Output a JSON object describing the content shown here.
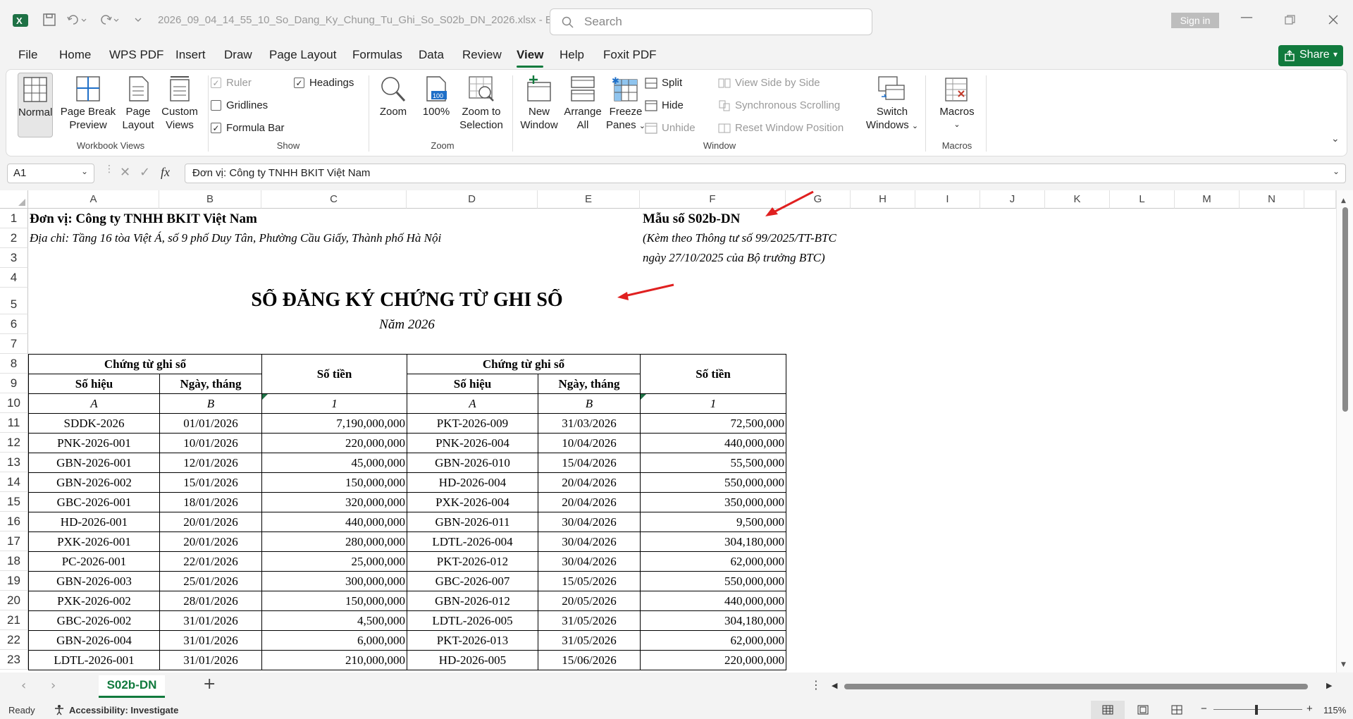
{
  "window": {
    "filename": "2026_09_04_14_55_10_So_Dang_Ky_Chung_Tu_Ghi_So_S02b_DN_2026.xlsx  -  E...",
    "search_placeholder": "Search",
    "signin": "Sign in"
  },
  "menu": [
    "File",
    "Home",
    "WPS PDF",
    "Insert",
    "Draw",
    "Page Layout",
    "Formulas",
    "Data",
    "Review",
    "View",
    "Help",
    "Foxit PDF"
  ],
  "active_menu": "View",
  "share_label": "Share",
  "ribbon": {
    "workbook_views": {
      "label": "Workbook Views",
      "normal": "Normal",
      "page_break": [
        "Page Break",
        "Preview"
      ],
      "page_layout": [
        "Page",
        "Layout"
      ],
      "custom": [
        "Custom",
        "Views"
      ]
    },
    "show": {
      "label": "Show",
      "ruler": "Ruler",
      "gridlines": "Gridlines",
      "formula_bar": "Formula Bar",
      "headings": "Headings"
    },
    "zoom": {
      "label": "Zoom",
      "zoom": "Zoom",
      "hundred": "100%",
      "selection": [
        "Zoom to",
        "Selection"
      ]
    },
    "window": {
      "label": "Window",
      "new_window": [
        "New",
        "Window"
      ],
      "arrange": [
        "Arrange",
        "All"
      ],
      "freeze": [
        "Freeze",
        "Panes"
      ],
      "split": "Split",
      "hide": "Hide",
      "unhide": "Unhide",
      "side_by_side": "View Side by Side",
      "sync": "Synchronous Scrolling",
      "reset": "Reset Window Position",
      "switch": [
        "Switch",
        "Windows"
      ]
    },
    "macros": {
      "label": "Macros",
      "macros": "Macros"
    }
  },
  "formula_bar": {
    "name_box": "A1",
    "formula": "Đơn vị: Công ty TNHH BKIT Việt Nam"
  },
  "columns": [
    "A",
    "B",
    "C",
    "D",
    "E",
    "F",
    "G",
    "H",
    "I",
    "J",
    "K",
    "L",
    "M",
    "N"
  ],
  "rows": [
    "1",
    "2",
    "3",
    "4",
    "5",
    "6",
    "7",
    "8",
    "9",
    "10",
    "11",
    "12",
    "13",
    "14",
    "15",
    "16",
    "17",
    "18",
    "19",
    "20",
    "21",
    "22",
    "23"
  ],
  "sheet": {
    "unit": "Đơn vị: Công ty TNHH BKIT Việt Nam",
    "address": "Địa chỉ: Tầng 16 tòa Việt Á, số 9 phố Duy Tân, Phường Cầu Giấy, Thành phố Hà Nội",
    "form_no": "Mẫu số S02b-DN",
    "form_note1": "(Kèm theo Thông tư số 99/2025/TT-BTC",
    "form_note2": "ngày 27/10/2025 của Bộ trưởng BTC)",
    "title": "SỔ ĐĂNG KÝ CHỨNG TỪ GHI SỔ",
    "year": "Năm 2026",
    "hdr_ctgs": "Chứng từ ghi sổ",
    "hdr_sotien": "Số tiền",
    "hdr_sohieu": "Số hiệu",
    "hdr_ngay": "Ngày, tháng",
    "code_a": "A",
    "code_b": "B",
    "code_1": "1",
    "data": [
      [
        "SDDK-2026",
        "01/01/2026",
        "7,190,000,000",
        "PKT-2026-009",
        "31/03/2026",
        "72,500,000"
      ],
      [
        "PNK-2026-001",
        "10/01/2026",
        "220,000,000",
        "PNK-2026-004",
        "10/04/2026",
        "440,000,000"
      ],
      [
        "GBN-2026-001",
        "12/01/2026",
        "45,000,000",
        "GBN-2026-010",
        "15/04/2026",
        "55,500,000"
      ],
      [
        "GBN-2026-002",
        "15/01/2026",
        "150,000,000",
        "HD-2026-004",
        "20/04/2026",
        "550,000,000"
      ],
      [
        "GBC-2026-001",
        "18/01/2026",
        "320,000,000",
        "PXK-2026-004",
        "20/04/2026",
        "350,000,000"
      ],
      [
        "HD-2026-001",
        "20/01/2026",
        "440,000,000",
        "GBN-2026-011",
        "30/04/2026",
        "9,500,000"
      ],
      [
        "PXK-2026-001",
        "20/01/2026",
        "280,000,000",
        "LDTL-2026-004",
        "30/04/2026",
        "304,180,000"
      ],
      [
        "PC-2026-001",
        "22/01/2026",
        "25,000,000",
        "PKT-2026-012",
        "30/04/2026",
        "62,000,000"
      ],
      [
        "GBN-2026-003",
        "25/01/2026",
        "300,000,000",
        "GBC-2026-007",
        "15/05/2026",
        "550,000,000"
      ],
      [
        "PXK-2026-002",
        "28/01/2026",
        "150,000,000",
        "GBN-2026-012",
        "20/05/2026",
        "440,000,000"
      ],
      [
        "GBC-2026-002",
        "31/01/2026",
        "4,500,000",
        "LDTL-2026-005",
        "31/05/2026",
        "304,180,000"
      ],
      [
        "GBN-2026-004",
        "31/01/2026",
        "6,000,000",
        "PKT-2026-013",
        "31/05/2026",
        "62,000,000"
      ],
      [
        "LDTL-2026-001",
        "31/01/2026",
        "210,000,000",
        "HD-2026-005",
        "15/06/2026",
        "220,000,000"
      ]
    ]
  },
  "sheet_tab": "S02b-DN",
  "status": {
    "ready": "Ready",
    "accessibility": "Accessibility: Investigate",
    "zoom": "115%"
  },
  "colors": {
    "accent": "#117a3d",
    "arrow": "#e02020"
  }
}
